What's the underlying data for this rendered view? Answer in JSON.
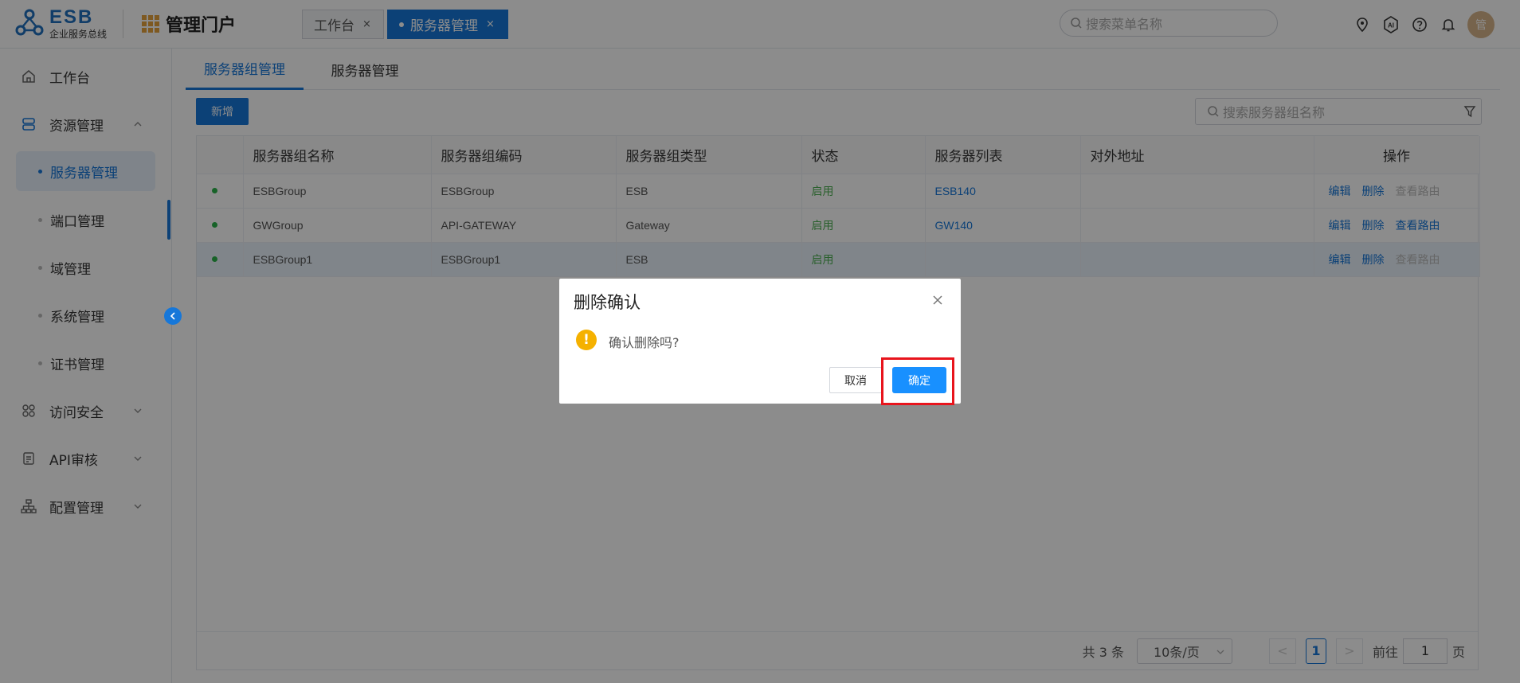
{
  "header": {
    "logo_text": "ESB",
    "logo_subtitle": "企业服务总线",
    "portal_title": "管理门户",
    "tabs": [
      {
        "label": "工作台",
        "close": "×"
      },
      {
        "label": "服务器管理",
        "close": "×"
      }
    ],
    "menu_search_placeholder": "搜索菜单名称",
    "icons": [
      "location-icon",
      "ai-icon",
      "help-icon",
      "bell-icon"
    ],
    "avatar_text": "管"
  },
  "sidebar": {
    "items": [
      {
        "label": "工作台",
        "icon": "home-icon"
      },
      {
        "label": "资源管理",
        "icon": "database-icon"
      },
      {
        "label": "访问安全",
        "icon": "grid-icon"
      },
      {
        "label": "API审核",
        "icon": "document-icon"
      },
      {
        "label": "配置管理",
        "icon": "org-tree-icon"
      }
    ],
    "sub_items": [
      "服务器管理",
      "端口管理",
      "域管理",
      "系统管理",
      "证书管理"
    ]
  },
  "main": {
    "subtabs": [
      "服务器组管理",
      "服务器管理"
    ],
    "add_button": "新增",
    "search_placeholder": "搜索服务器组名称",
    "table": {
      "headers": [
        "",
        "服务器组名称",
        "服务器组编码",
        "服务器组类型",
        "状态",
        "服务器列表",
        "对外地址",
        "操作"
      ],
      "rows": [
        {
          "name": "ESBGroup",
          "code": "ESBGroup",
          "type": "ESB",
          "state": "启用",
          "servers": "ESB140",
          "address": "",
          "op_edit": "编辑",
          "op_delete": "删除",
          "op_route": "查看路由",
          "route_enabled": false
        },
        {
          "name": "GWGroup",
          "code": "API-GATEWAY",
          "type": "Gateway",
          "state": "启用",
          "servers": "GW140",
          "address": "",
          "op_edit": "编辑",
          "op_delete": "删除",
          "op_route": "查看路由",
          "route_enabled": true
        },
        {
          "name": "ESBGroup1",
          "code": "ESBGroup1",
          "type": "ESB",
          "state": "启用",
          "servers": "",
          "address": "",
          "op_edit": "编辑",
          "op_delete": "删除",
          "op_route": "查看路由",
          "route_enabled": false
        }
      ]
    },
    "pager": {
      "total": "共 3 条",
      "page_size": "10条/页",
      "prev": "<",
      "current_page": "1",
      "next": ">",
      "goto_label": "前往",
      "goto_value": "1",
      "page_suffix": "页"
    }
  },
  "dialog": {
    "title": "删除确认",
    "message": "确认删除吗?",
    "warn_glyph": "!",
    "cancel": "取消",
    "confirm": "确定"
  },
  "colors": {
    "primary": "#1677d9",
    "status_green": "#4caf50",
    "warning": "#f5b100",
    "highlight_red": "#e8141c"
  }
}
